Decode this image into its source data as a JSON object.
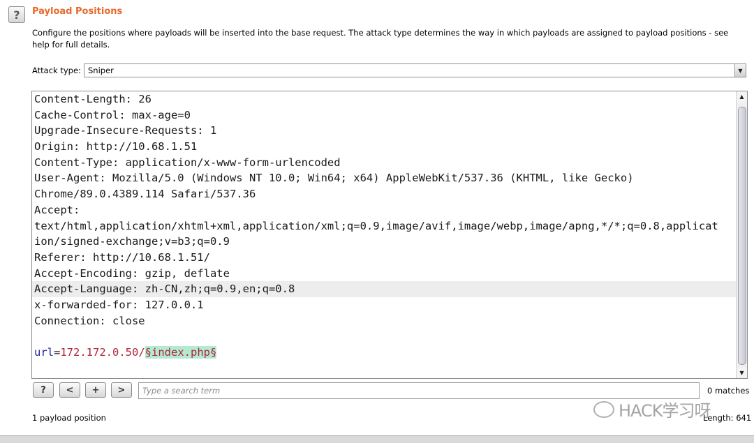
{
  "header": {
    "help_icon": "?",
    "title": "Payload Positions",
    "description": "Configure the positions where payloads will be inserted into the base request. The attack type determines the way in which payloads are assigned to payload positions - see help for full details."
  },
  "attack_type": {
    "label": "Attack type:",
    "value": "Sniper"
  },
  "request": {
    "lines": [
      "Content-Length: 26",
      "Cache-Control: max-age=0",
      "Upgrade-Insecure-Requests: 1",
      "Origin: http://10.68.1.51",
      "Content-Type: application/x-www-form-urlencoded",
      "User-Agent: Mozilla/5.0 (Windows NT 10.0; Win64; x64) AppleWebKit/537.36 (KHTML, like Gecko)",
      "Chrome/89.0.4389.114 Safari/537.36",
      "Accept:",
      "text/html,application/xhtml+xml,application/xml;q=0.9,image/avif,image/webp,image/apng,*/*;q=0.8,applicat",
      "ion/signed-exchange;v=b3;q=0.9",
      "Referer: http://10.68.1.51/",
      "Accept-Encoding: gzip, deflate",
      "Accept-Language: zh-CN,zh;q=0.9,en;q=0.8",
      "x-forwarded-for: 127.0.0.1",
      "Connection: close"
    ],
    "body_param_name": "url",
    "body_equals": "=",
    "body_param_value": "172.172.0.50/",
    "payload_marker": "§index.php§"
  },
  "toolbar": {
    "help_label": "?",
    "prev_label": "<",
    "add_label": "+",
    "next_label": ">",
    "search_placeholder": "Type a search term",
    "matches": "0 matches"
  },
  "status": {
    "payload_positions": "1 payload position",
    "length": "Length: 641"
  },
  "watermark": {
    "text": "HACK学习呀"
  }
}
